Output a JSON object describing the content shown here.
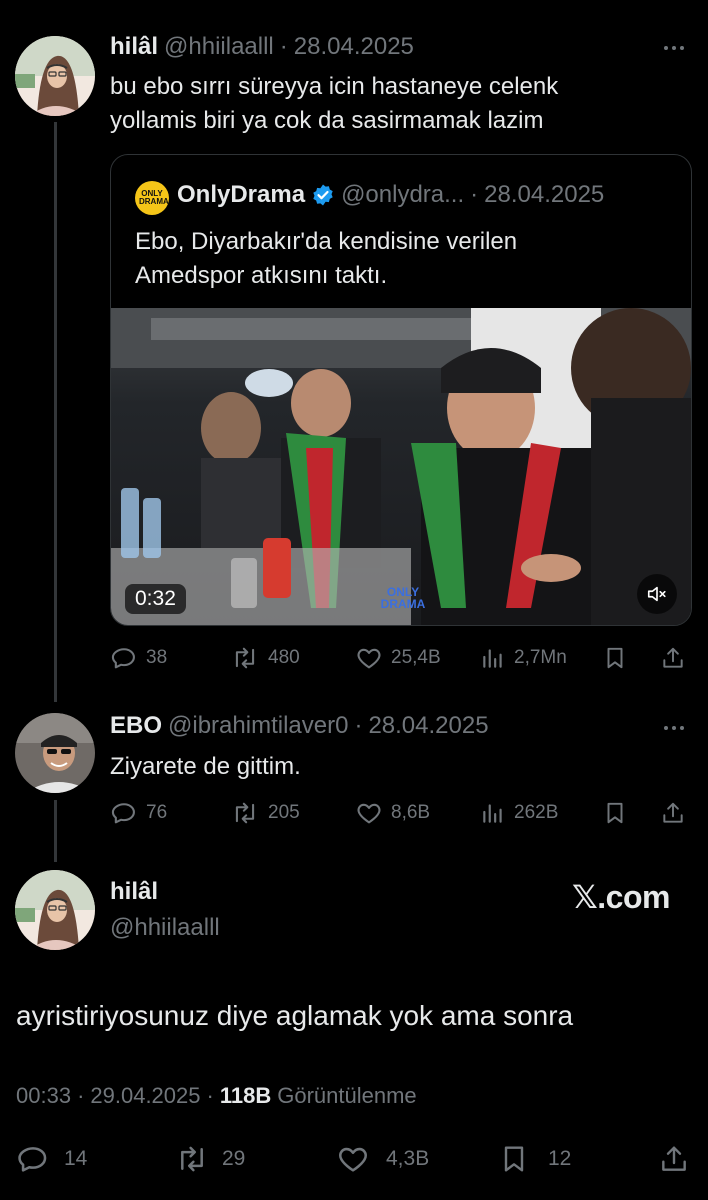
{
  "tweet1": {
    "name": "hilâl",
    "handle": "@hhiilaalll",
    "sep": "·",
    "date": "28.04.2025",
    "text_line1": "bu ebo sırrı süreyya icin hastaneye celenk",
    "text_line2": "yollamis biri ya cok da sasirmamak lazim"
  },
  "quote": {
    "logo_text": "ONLY DRAMA",
    "name": "OnlyDrama",
    "handle": "@onlydra...",
    "sep": "·",
    "date": "28.04.2025",
    "text_line1": "Ebo, Diyarbakır'da kendisine verilen",
    "text_line2": "Amedspor atkısını taktı.",
    "video_duration": "0:32",
    "watermark": "ONLY DRAMA",
    "stats": {
      "replies": "38",
      "reposts": "480",
      "likes": "25,4B",
      "views": "2,7Mn"
    }
  },
  "tweet2": {
    "name": "EBO",
    "handle": "@ibrahimtilaver0",
    "sep": "·",
    "date": "28.04.2025",
    "text": "Ziyarete de gittim.",
    "stats": {
      "replies": "76",
      "reposts": "205",
      "likes": "8,6B",
      "views": "262B"
    }
  },
  "main": {
    "name": "hilâl",
    "handle": "@hhiilaalll",
    "brand": "𝕏.com",
    "text": "ayristiriyosunuz diye aglamak yok ama sonra",
    "time": "00:33",
    "sep1": "·",
    "date": "29.04.2025",
    "sep2": "·",
    "views_count": "118B",
    "views_label": "Görüntülenme",
    "stats": {
      "replies": "14",
      "reposts": "29",
      "likes": "4,3B",
      "bookmarks": "12"
    }
  },
  "colors": {
    "background": "#000000",
    "text": "#e7e9ea",
    "muted": "#71767b",
    "verified": "#1d9bf0"
  }
}
